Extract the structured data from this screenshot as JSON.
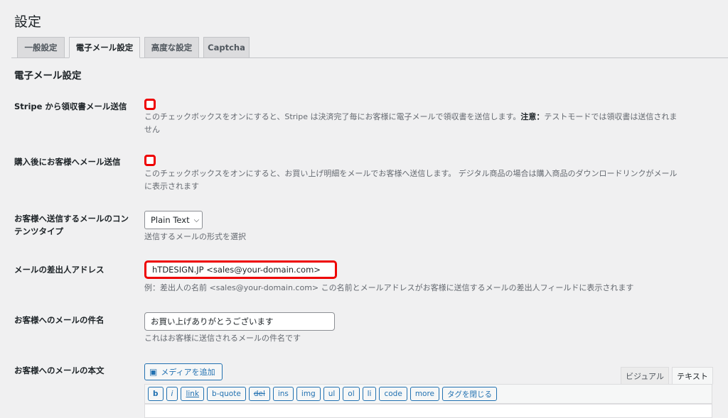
{
  "page": {
    "title": "設定"
  },
  "tabs": [
    {
      "label": "一般設定"
    },
    {
      "label": "電子メール設定"
    },
    {
      "label": "高度な設定"
    },
    {
      "label": "Captcha"
    }
  ],
  "section_title": "電子メール設定",
  "fields": {
    "stripe_receipt": {
      "label": "Stripe から領収書メール送信",
      "checked": false,
      "desc1": "このチェックボックスをオンにすると、Stripe は決済完了毎にお客様に電子メールで領収書を送信します。",
      "desc_strong": "注意：",
      "desc2": "テストモードでは領収書は送信されま",
      "desc3": "せん"
    },
    "buyer_email": {
      "label": "購入後にお客様へメール送信",
      "checked": false,
      "desc1": "このチェックボックスをオンにすると、お買い上げ明細をメールでお客様へ送信します。 デジタル商品の場合は購入商品のダウンロードリンクがメール",
      "desc2": "に表示されます"
    },
    "content_type": {
      "label1": "お客様へ送信するメールのコン",
      "label2": "テンツタイプ",
      "value": "Plain Text",
      "desc": "送信するメールの形式を選択"
    },
    "from": {
      "label": "メールの差出人アドレス",
      "value": "hTDESIGN.JP <sales@your-domain.com>",
      "desc": "例：差出人の名前 <sales@your-domain.com> この名前とメールアドレスがお客様に送信するメールの差出人フィールドに表示されます"
    },
    "subject": {
      "label": "お客様へのメールの件名",
      "value": "お買い上げありがとうございます",
      "desc": "これはお客様に送信されるメールの件名です"
    },
    "body": {
      "label": "お客様へのメールの本文",
      "media_button": "メディアを追加",
      "tab_visual": "ビジュアル",
      "tab_text": "テキスト",
      "quicktags": [
        "b",
        "i",
        "link",
        "b-quote",
        "del",
        "ins",
        "img",
        "ul",
        "ol",
        "li",
        "code",
        "more",
        "タグを閉じる"
      ]
    }
  },
  "colors": {
    "highlight": "#e00000",
    "accent": "#2271b1"
  }
}
